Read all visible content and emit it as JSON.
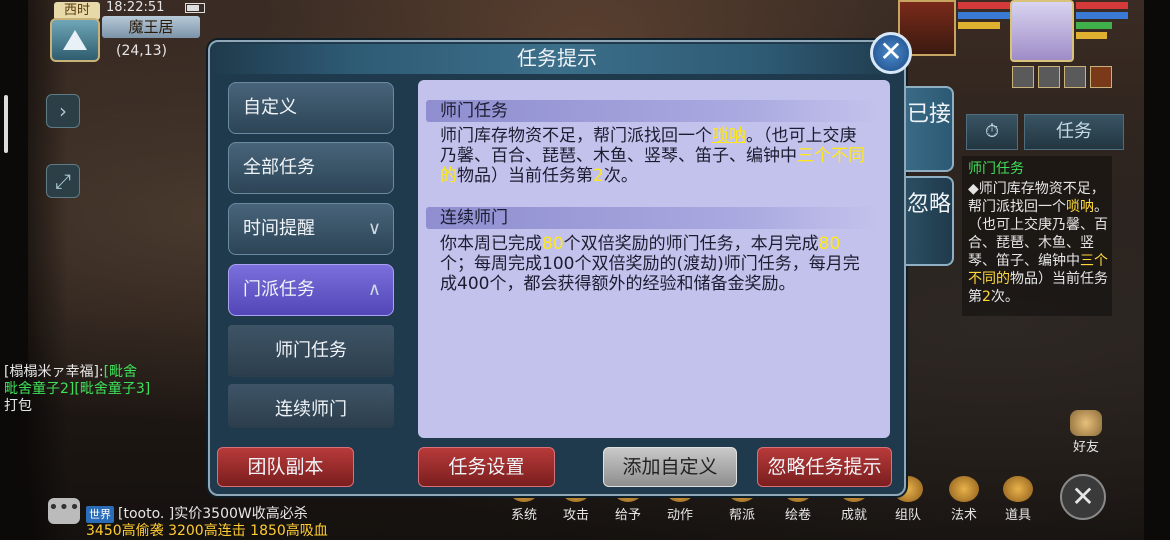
{
  "status": {
    "time_tag": "西时",
    "clock": "18:22:51",
    "location": "魔王居",
    "coords": "(24,13)"
  },
  "chat_left": {
    "line1_name": "[榻榻米ァ幸福]:",
    "line1_green": "[毗舍",
    "line2": "毗舍童子2][毗舍童子3]",
    "line3": "打包"
  },
  "dialog": {
    "title": "任务提示",
    "categories": [
      {
        "label": "自定义"
      },
      {
        "label": "全部任务"
      },
      {
        "label": "时间提醒",
        "chevron": "∨"
      },
      {
        "label": "门派任务",
        "chevron": "∧"
      }
    ],
    "subitems": [
      "师门任务",
      "连续师门"
    ],
    "sections": [
      {
        "heading": "师门任务",
        "t1": "师门库存物资不足，帮门派找回一个",
        "t2": "唢呐",
        "t3": "。（也可上交庚乃馨、百合、琵琶、木鱼、竖琴、笛子、编钟中",
        "t4": "三个不同的",
        "t5": "物品）当前任务第",
        "t6": "2",
        "t7": "次。"
      },
      {
        "heading": "连续师门",
        "t1": "你本周已完成",
        "t2": "80",
        "t3": "个双倍奖励的师门任务，本月完成",
        "t4": "80",
        "t5": "个；每周完成100个双倍奖励的(渡劫)师门任务，每月完成400个，都会获得额外的经验和储备金奖励。"
      }
    ],
    "side_tabs": [
      "已接",
      "忽略"
    ],
    "buttons": {
      "team": "团队副本",
      "settings": "任务设置",
      "add_custom": "添加自定义",
      "ignore": "忽略任务提示"
    }
  },
  "tracker": {
    "timer_icon": "⏱",
    "tab_label": "任务",
    "title": "师门任务",
    "t1": "◆师门库存物资不足，帮门派找回一个",
    "t2": "唢呐",
    "t3": "。（也可上交庚乃馨、百合、琵琶、木鱼、竖琴、笛子、编钟中",
    "t4": "三个不同的",
    "t5": "物品）当前任务第",
    "t6": "2",
    "t7": "次。"
  },
  "bottom_menu": [
    "系统",
    "攻击",
    "给予",
    "动作",
    "帮派",
    "绘卷",
    "成就",
    "组队",
    "法术",
    "道具"
  ],
  "friends_label": "好友",
  "world_chat": {
    "tag": "世界",
    "line1": "[tooto.  ]实价3500W收高必杀",
    "line2": "3450高偷袭 3200高连击 1850高吸血"
  },
  "colors": {
    "accent_yellow": "#ffe81a",
    "quest_green": "#3fe05a",
    "active_tab": "#5346b8",
    "red_button": "#b83a3a"
  }
}
